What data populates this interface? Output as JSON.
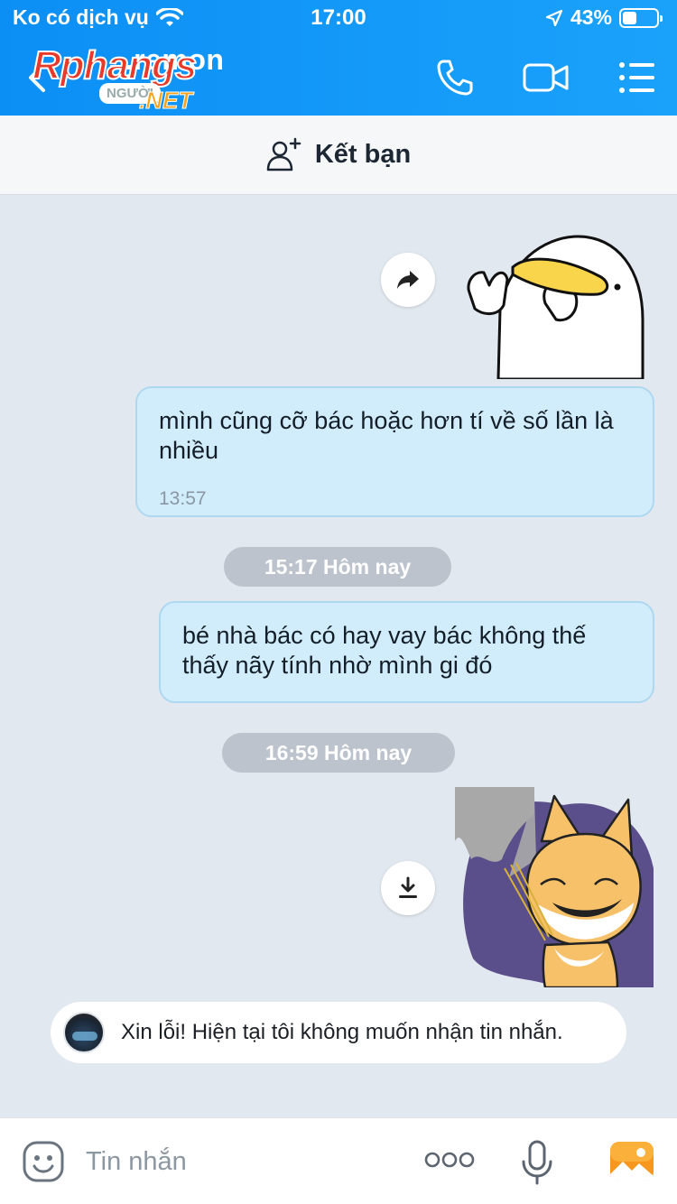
{
  "status_bar": {
    "carrier": "Ko có dịch vụ",
    "time": "17:00",
    "battery": "43%",
    "battery_level": 0.43
  },
  "header": {
    "title": "...remon"
  },
  "friend_bar": {
    "label": "Kết bạn"
  },
  "messages": [
    {
      "text": "mình cũng cỡ bác hoặc hơn tí về số lần là nhiều",
      "time": "13:57"
    },
    {
      "text": "bé nhà bác có hay vay bác không thế thấy nãy tính nhờ mình gi đó"
    }
  ],
  "date_separators": [
    "15:17 Hôm nay",
    "16:59 Hôm nay"
  ],
  "auto_reply": {
    "text": "Xin lỗi! Hiện tại tôi không muốn nhận tin nhắn."
  },
  "composer": {
    "placeholder": "Tin nhắn"
  },
  "watermark": {
    "main": "Rphangs",
    "badge": "NGƯỜI",
    "suffix": ".NET"
  },
  "colors": {
    "header": "#1aa2fb",
    "bubble": "#d1edfb",
    "background": "#e2e8ef"
  }
}
